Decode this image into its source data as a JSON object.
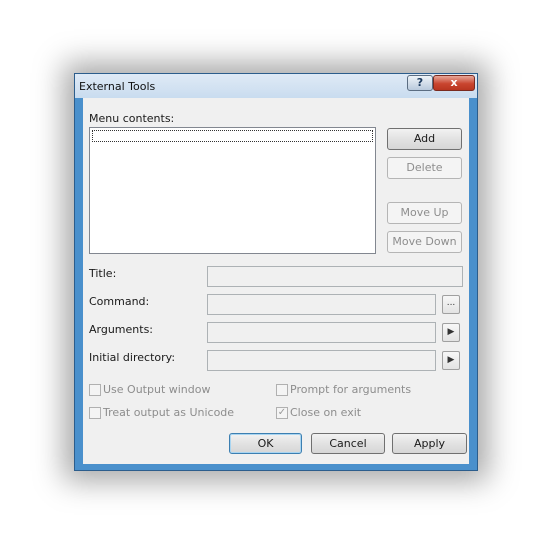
{
  "window": {
    "title": "External Tools",
    "help_label": "?",
    "close_label": "x"
  },
  "menu_contents_label": "Menu contents:",
  "side_buttons": {
    "add": "Add",
    "delete": "Delete",
    "move_up": "Move Up",
    "move_down": "Move Down"
  },
  "fields": {
    "title": {
      "label": "Title:",
      "value": ""
    },
    "command": {
      "label": "Command:",
      "value": "",
      "browse": "..."
    },
    "arguments": {
      "label": "Arguments:",
      "value": "",
      "arrow": "▶"
    },
    "initial_directory": {
      "label": "Initial directory:",
      "value": "",
      "arrow": "▶"
    }
  },
  "options": {
    "use_output_window": {
      "label": "Use Output window",
      "checked": false
    },
    "treat_output_unicode": {
      "label": "Treat output as Unicode",
      "checked": false
    },
    "prompt_for_arguments": {
      "label": "Prompt for arguments",
      "checked": false
    },
    "close_on_exit": {
      "label": "Close on exit",
      "checked": true,
      "mark": "✓"
    }
  },
  "footer": {
    "ok": "OK",
    "cancel": "Cancel",
    "apply": "Apply"
  }
}
